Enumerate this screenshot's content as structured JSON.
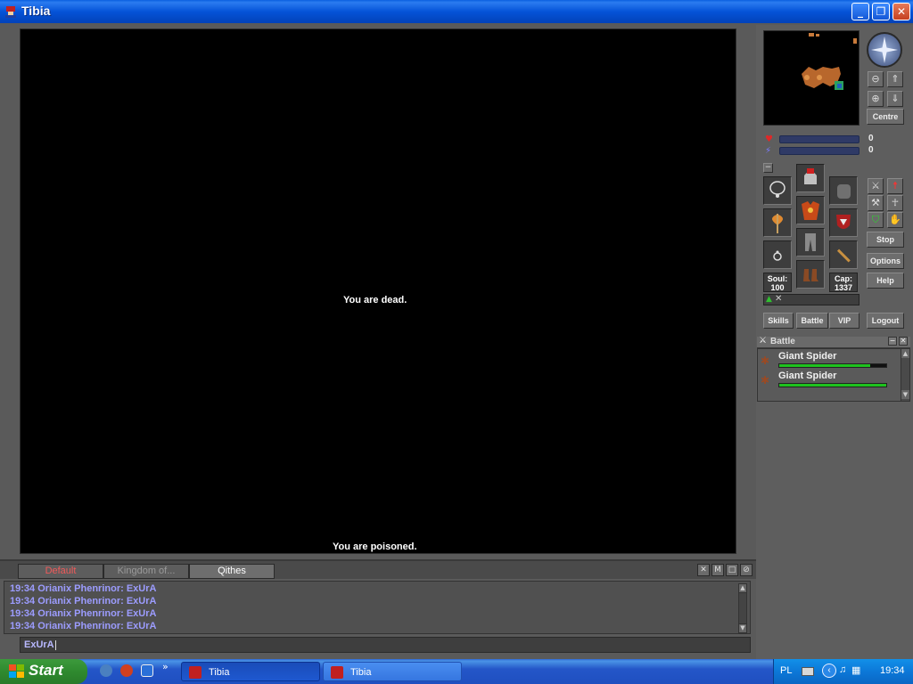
{
  "window": {
    "title": "Tibia",
    "controls": {
      "minimize": "_",
      "restore": "❐",
      "close": "✕"
    }
  },
  "game": {
    "center_message": "You are dead.",
    "status_message": "You are poisoned."
  },
  "chat": {
    "tabs": [
      {
        "label": "Default",
        "state": "highlighted"
      },
      {
        "label": "Kingdom of...",
        "state": "inactive"
      },
      {
        "label": "Qithes",
        "state": "active"
      }
    ],
    "controls": {
      "close": "✕",
      "m": "M",
      "window": "□",
      "ignore": "⊘"
    },
    "lines": [
      "19:34 Orianix Phenrinor: ExUrA",
      "19:34 Orianix Phenrinor: ExUrA",
      "19:34 Orianix Phenrinor: ExUrA",
      "19:34 Orianix Phenrinor: ExUrA"
    ],
    "input_value": "ExUrA"
  },
  "minimap": {
    "centre_label": "Centre"
  },
  "stats": {
    "health_value": "0",
    "mana_value": "0",
    "soul_label": "Soul:",
    "soul_value": "100",
    "cap_label": "Cap:",
    "cap_value": "1337"
  },
  "side_buttons": {
    "stop": "Stop",
    "options": "Options",
    "help": "Help",
    "skills": "Skills",
    "battle": "Battle",
    "vip": "VIP",
    "logout": "Logout"
  },
  "battle": {
    "title": "Battle",
    "creatures": [
      {
        "name": "Giant Spider",
        "health_fraction": 0.85
      },
      {
        "name": "Giant Spider",
        "health_fraction": 1.0
      }
    ]
  },
  "taskbar": {
    "start_label": "Start",
    "tasks": [
      {
        "label": "Tibia",
        "active": true
      },
      {
        "label": "Tibia",
        "active": false
      }
    ],
    "language": "PL",
    "clock": "19:34"
  },
  "colors": {
    "chat_text": "#9c9cff",
    "default_tab": "#f05a5a",
    "hp_bar": "#1ec21e"
  }
}
